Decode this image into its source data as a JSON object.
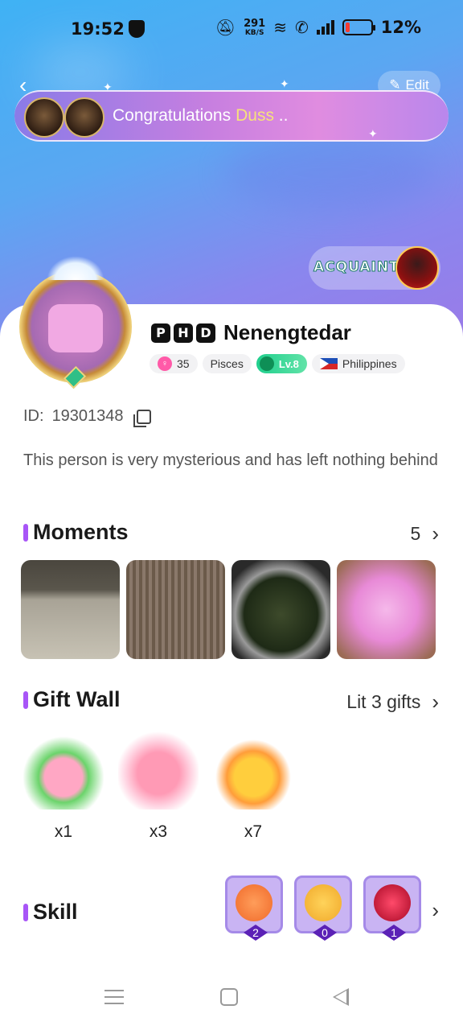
{
  "status_bar": {
    "time": "19:52",
    "net_speed_value": "291",
    "net_speed_unit": "KB/S",
    "battery": "12%"
  },
  "header": {
    "edit_label": "Edit"
  },
  "banner": {
    "text": "Congratulations",
    "name": "Duss"
  },
  "acquaint": {
    "label": "ACQUAINT"
  },
  "profile": {
    "tags": [
      "P",
      "H",
      "D"
    ],
    "name": "Nenengtedar",
    "chips": {
      "age": "35",
      "zodiac": "Pisces",
      "level": "Lv.8",
      "country": "Philippines"
    },
    "id_label": "ID:",
    "id_value": "19301348",
    "bio": "This person is very mysterious and has left nothing behind"
  },
  "moments": {
    "title": "Moments",
    "count": "5"
  },
  "gift_wall": {
    "title": "Gift Wall",
    "summary": "Lit 3 gifts",
    "gifts": [
      {
        "count": "x1"
      },
      {
        "count": "x3"
      },
      {
        "count": "x7"
      }
    ]
  },
  "skill": {
    "title": "Skill",
    "items": [
      {
        "level": "2"
      },
      {
        "level": "0"
      },
      {
        "level": "1"
      }
    ]
  },
  "colors": {
    "accent": "#a855f7",
    "level_chip": "#1fcf8d",
    "hero_top": "#3fb2f4",
    "hero_bottom": "#9a7be8"
  }
}
